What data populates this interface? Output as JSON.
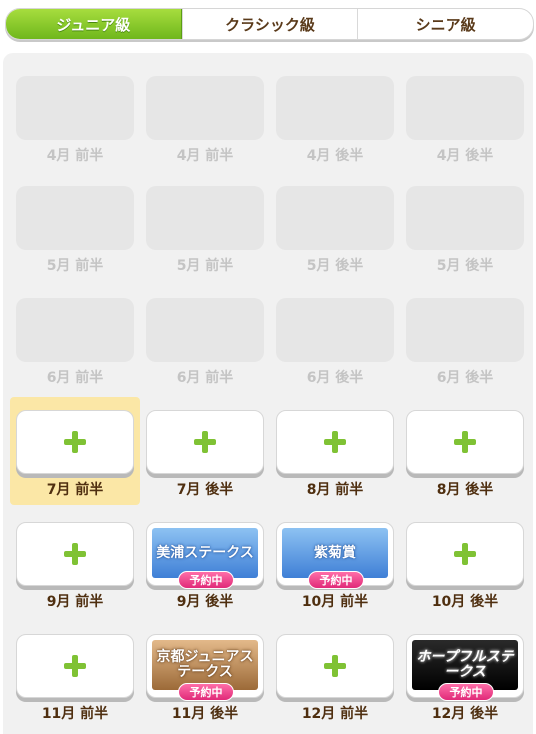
{
  "tabs": [
    "ジュニア級",
    "クラシック級",
    "シニア級"
  ],
  "rows": [
    [
      {
        "label": "4月 前半",
        "type": "empty"
      },
      {
        "label": "4月 前半",
        "type": "empty"
      },
      {
        "label": "4月 後半",
        "type": "empty"
      },
      {
        "label": "4月 後半",
        "type": "empty"
      }
    ],
    [
      {
        "label": "5月 前半",
        "type": "empty"
      },
      {
        "label": "5月 前半",
        "type": "empty"
      },
      {
        "label": "5月 後半",
        "type": "empty"
      },
      {
        "label": "5月 後半",
        "type": "empty"
      }
    ],
    [
      {
        "label": "6月 前半",
        "type": "empty"
      },
      {
        "label": "6月 前半",
        "type": "empty"
      },
      {
        "label": "6月 後半",
        "type": "empty"
      },
      {
        "label": "6月 後半",
        "type": "empty"
      }
    ],
    [
      {
        "label": "7月 前半",
        "type": "add",
        "selected": true
      },
      {
        "label": "7月 後半",
        "type": "add"
      },
      {
        "label": "8月 前半",
        "type": "add"
      },
      {
        "label": "8月 後半",
        "type": "add"
      }
    ],
    [
      {
        "label": "9月 前半",
        "type": "add"
      },
      {
        "label": "9月 後半",
        "type": "race",
        "race": "美浦ステークス",
        "style": "blue",
        "badge": "予約中"
      },
      {
        "label": "10月 前半",
        "type": "race",
        "race": "紫菊賞",
        "style": "blue",
        "badge": "予約中"
      },
      {
        "label": "10月 後半",
        "type": "add"
      }
    ],
    [
      {
        "label": "11月 前半",
        "type": "add"
      },
      {
        "label": "11月 後半",
        "type": "race",
        "race": "京都ジュニアステークス",
        "style": "bronze",
        "badge": "予約中"
      },
      {
        "label": "12月 前半",
        "type": "add"
      },
      {
        "label": "12月 後半",
        "type": "race",
        "race": "ホープフルステークス",
        "style": "black",
        "badge": "予約中"
      }
    ]
  ]
}
